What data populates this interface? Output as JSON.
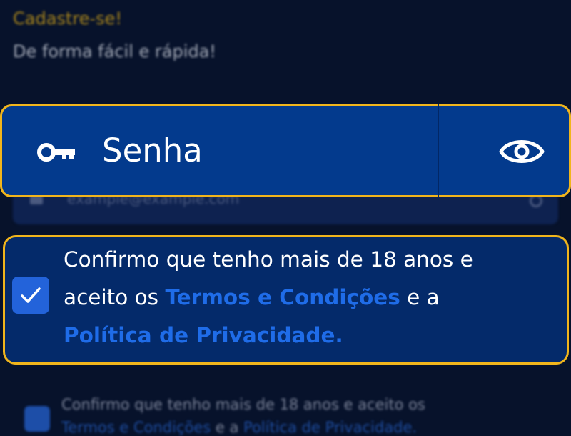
{
  "header": {
    "title": "Cadastre-se!",
    "subtitle": "De forma fácil e rápida!"
  },
  "email_field": {
    "placeholder": "example@example.com",
    "icon": "envelope-icon"
  },
  "password_field": {
    "placeholder": "Senha",
    "leading_icon": "key-icon",
    "trailing_icon": "eye-icon"
  },
  "consent": {
    "checked": true,
    "line1": "Confirmo que tenho mais de 18 anos e",
    "line2_prefix": "aceito os ",
    "terms_link": "Termos e Condições",
    "line2_suffix": " e a",
    "privacy_link": "Política de Privacidade."
  },
  "consent_background": {
    "line1": "Confirmo que tenho mais de 18 anos e aceito os",
    "terms_link": "Termos e Condições",
    "connector": " e a ",
    "privacy_link": "Política de Privacidade."
  },
  "colors": {
    "background": "#07122b",
    "field": "#033a8d",
    "focus_border": "#f1b51c",
    "link": "#1f6ce8",
    "checkbox": "#2363da",
    "title_accent": "#a8851c"
  }
}
